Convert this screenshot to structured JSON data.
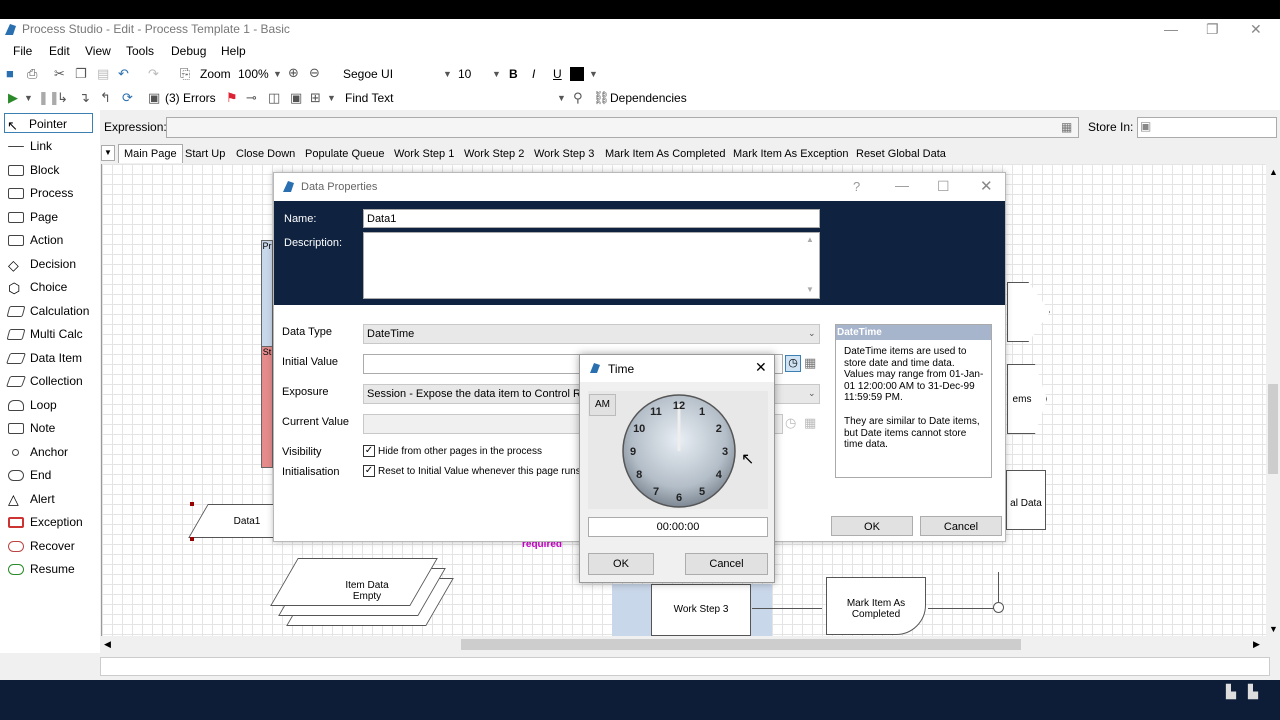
{
  "window": {
    "title": "Process Studio - Edit - Process Template 1 - Basic",
    "minimize": "—",
    "restore": "❐",
    "close": "✕"
  },
  "menu": [
    "File",
    "Edit",
    "View",
    "Tools",
    "Debug",
    "Help"
  ],
  "toolbar": {
    "zoom_label": "Zoom",
    "zoom_value": "100%",
    "font_name": "Segoe UI",
    "font_size": "10",
    "bold": "B",
    "italic": "I",
    "underline": "U",
    "errors": "(3) Errors",
    "find_text": "Find Text",
    "dependencies": "Dependencies"
  },
  "tools": [
    "Pointer",
    "Link",
    "Block",
    "Process",
    "Page",
    "Action",
    "Decision",
    "Choice",
    "Calculation",
    "Multi Calc",
    "Data Item",
    "Collection",
    "Loop",
    "Note",
    "Anchor",
    "End",
    "Alert",
    "Exception",
    "Recover",
    "Resume"
  ],
  "expression": {
    "label": "Expression:",
    "store_in": "Store In:"
  },
  "tabs": [
    "Main Page",
    "Start Up",
    "Close Down",
    "Populate Queue",
    "Work Step 1",
    "Work Step 2",
    "Work Step 3",
    "Mark Item As Completed",
    "Mark Item As Exception",
    "Reset Global Data"
  ],
  "canvas": {
    "data1": "Data1",
    "required": "required",
    "item_data": "Item Data\nEmpty",
    "work_step": "Work Step 3",
    "mark_item": "Mark Item As\nCompleted",
    "ems": "ems",
    "al_data": "al Data",
    "pr": "Pr",
    "st": "St"
  },
  "data_properties": {
    "title": "Data Properties",
    "help": "?",
    "name_label": "Name:",
    "name_value": "Data1",
    "desc_label": "Description:",
    "data_type_label": "Data Type",
    "data_type_value": "DateTime",
    "initial_value_label": "Initial Value",
    "exposure_label": "Exposure",
    "exposure_value": "Session - Expose the data item to Control Room",
    "current_value_label": "Current Value",
    "visibility_label": "Visibility",
    "visibility_text": "Hide from other pages in the process",
    "initialisation_label": "Initialisation",
    "initialisation_text": "Reset to Initial Value whenever this page runs",
    "ok": "OK",
    "cancel": "Cancel",
    "info_title": "DateTime",
    "info_text1": "DateTime items are used to store date and time data. Values may range from 01-Jan-01 12:00:00 AM to 31-Dec-99 11:59:59 PM.",
    "info_text2": "They are similar to Date items, but Date items cannot store time data."
  },
  "time_dialog": {
    "title": "Time",
    "ampm": "AM",
    "value": "00:00:00",
    "ok": "OK",
    "cancel": "Cancel",
    "numbers": [
      "12",
      "1",
      "2",
      "3",
      "4",
      "5",
      "6",
      "7",
      "8",
      "9",
      "10",
      "11"
    ]
  }
}
